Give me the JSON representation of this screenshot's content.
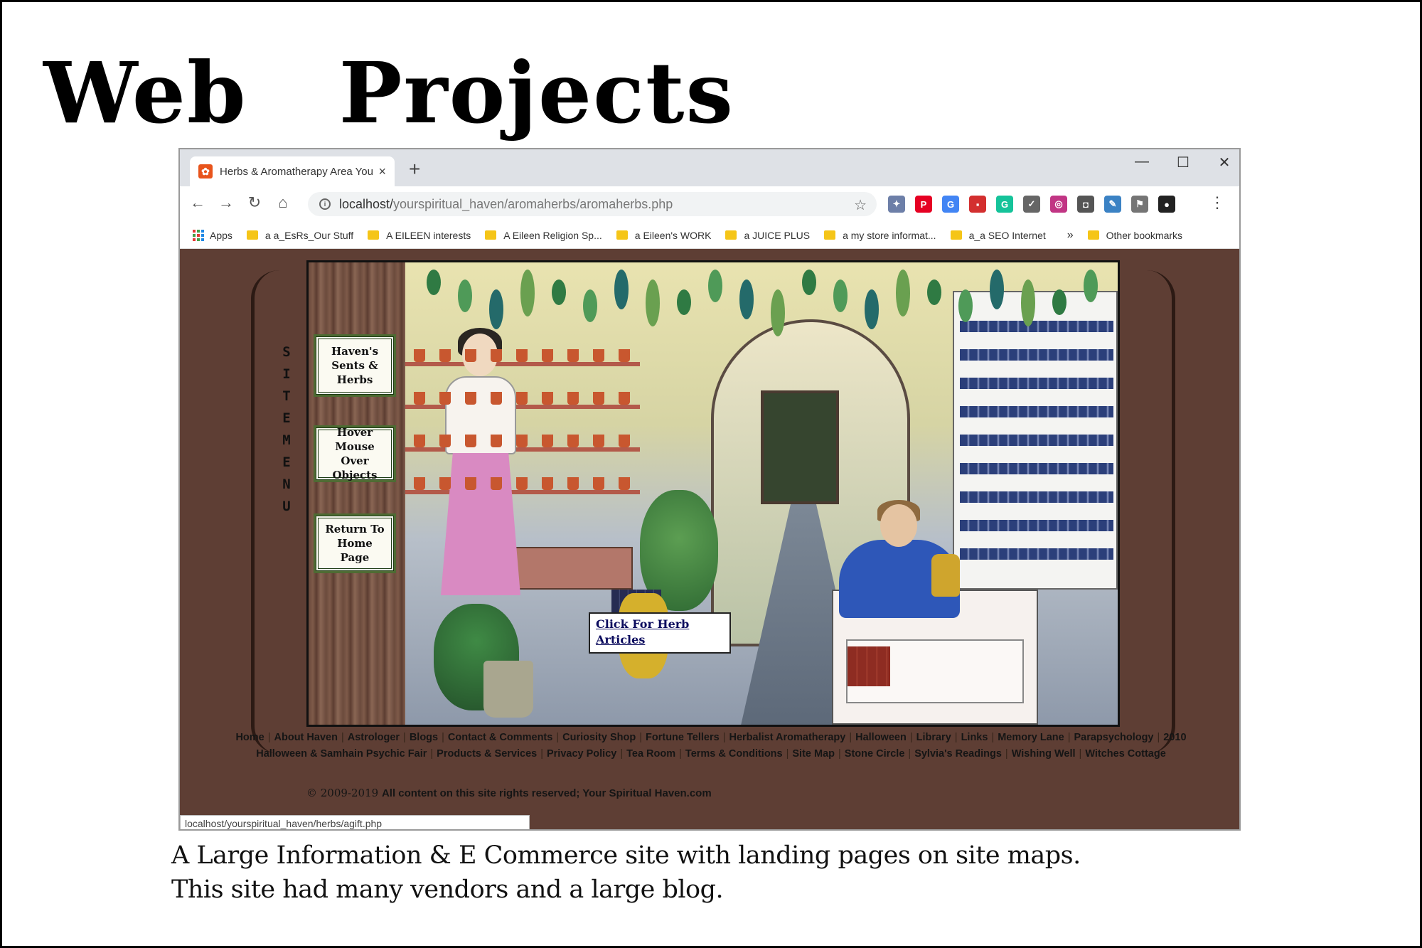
{
  "slide": {
    "title": "Web   Projects",
    "caption_line1": "A Large Information & E Commerce site with landing pages on site maps.",
    "caption_line2": "This site had many vendors and a large blog."
  },
  "browser": {
    "tab_title": "Herbs & Aromatherapy Area You",
    "tab_close": "×",
    "new_tab": "+",
    "window_controls": [
      "—",
      "☐",
      "✕"
    ],
    "nav": {
      "back": "←",
      "forward": "→",
      "reload": "↻",
      "home": "⌂"
    },
    "url_host": "localhost/",
    "url_path": "yourspiritual_haven/aromaherbs/aromaherbs.php",
    "star": "☆",
    "menu": "⋮",
    "bookmarks": [
      "Apps",
      "a a_EsRs_Our Stuff",
      "A EILEEN interests",
      "A Eileen Religion Sp...",
      "a Eileen's WORK",
      "a JUICE PLUS",
      "a my store informat...",
      "a_a SEO Internet"
    ],
    "bookmarks_more": "»",
    "other_bookmarks": "Other bookmarks",
    "status_url": "localhost/yourspiritual_haven/herbs/agift.php",
    "extensions": [
      {
        "name": "puzzle-extension-icon",
        "color": "#6d7fa8",
        "glyph": "✦"
      },
      {
        "name": "pinterest-icon",
        "color": "#e60023",
        "glyph": "P"
      },
      {
        "name": "translate-icon",
        "color": "#4285f4",
        "glyph": "G"
      },
      {
        "name": "red-square-extension-icon",
        "color": "#d32f2f",
        "glyph": "▪"
      },
      {
        "name": "grammarly-icon",
        "color": "#15c39a",
        "glyph": "G"
      },
      {
        "name": "pocket-icon",
        "color": "#666666",
        "glyph": "✓"
      },
      {
        "name": "instagram-icon",
        "color": "#c13584",
        "glyph": "◎"
      },
      {
        "name": "camera-icon",
        "color": "#555555",
        "glyph": "◘"
      },
      {
        "name": "pen-extension-icon",
        "color": "#3b82c4",
        "glyph": "✎"
      },
      {
        "name": "flag-extension-icon",
        "color": "#757575",
        "glyph": "⚑"
      },
      {
        "name": "profile-avatar-icon",
        "color": "#222222",
        "glyph": "●"
      }
    ]
  },
  "site": {
    "site_menu_label": "SITE MENU",
    "menu_buttons": [
      "Haven's Sents & Herbs",
      "Hover Mouse Over Objects",
      "Return To Home Page"
    ],
    "herb_link": "Click For Herb Articles",
    "footer_links": [
      "Home",
      "About Haven",
      "Astrologer",
      "Blogs",
      "Contact & Comments",
      "Curiosity Shop",
      "Fortune Tellers",
      "Herbalist Aromatherapy",
      "Halloween",
      "Library",
      "Links",
      "Memory Lane",
      "Parapsychology",
      "2010 Halloween & Samhain Psychic Fair",
      "Products & Services",
      "Privacy Policy",
      "Tea Room",
      "Terms & Conditions",
      "Site Map",
      "Stone Circle",
      "Sylvia's Readings",
      "Wishing Well",
      "Witches Cottage"
    ],
    "copyright_symbol": "© 2009-2019",
    "copyright_text": "All content on this site rights reserved; Your Spiritual Haven.com"
  }
}
